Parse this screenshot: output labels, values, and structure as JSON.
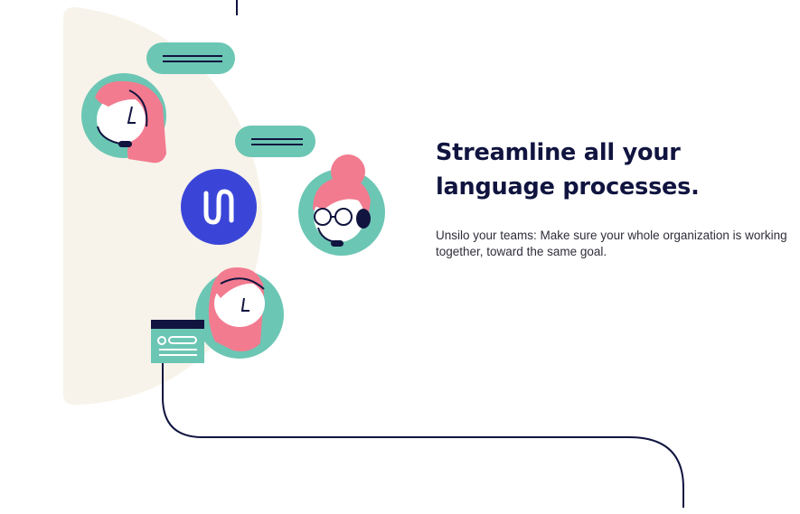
{
  "section": {
    "headline": "Streamline all your language processes.",
    "body": "Unsilo your teams: Make sure your whole organization is working together, toward the same goal."
  },
  "illustration": {
    "logo_glyph": "∪",
    "icons": [
      "headset-agent-icon",
      "chat-bubble-icon",
      "glasses-agent-icon",
      "brand-logo-icon",
      "browser-window-icon"
    ]
  },
  "colors": {
    "teal": "#6cc6b4",
    "pink": "#f27b8f",
    "navy": "#10143f",
    "blob": "#f7f3ea",
    "brand_blue": "#3a45d8"
  }
}
